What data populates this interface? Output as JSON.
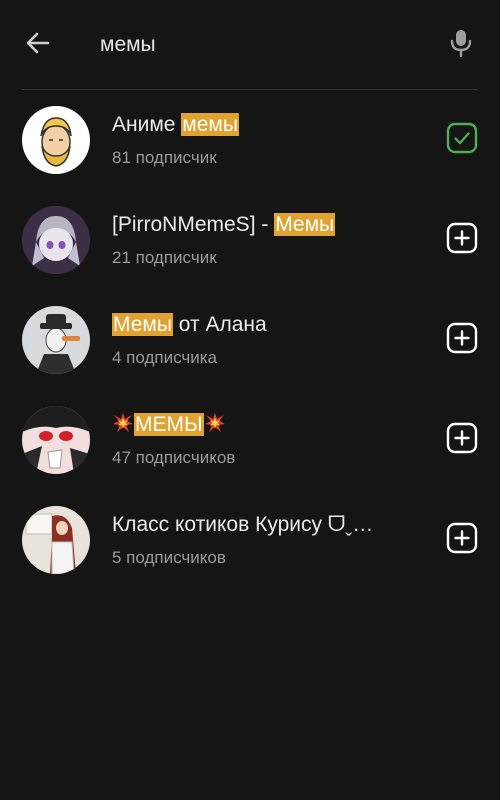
{
  "search": {
    "query": "мемы",
    "back_icon": "arrow-left-icon",
    "mic_icon": "microphone-icon"
  },
  "colors": {
    "background": "#151515",
    "highlight": "#e0a230",
    "subscribed": "#4caf50",
    "text_primary": "#ececec",
    "text_secondary": "#9a9a9a"
  },
  "results": [
    {
      "name_before": "Аниме ",
      "name_highlight": "мемы",
      "name_after": "",
      "subscribers": "81 подписчик",
      "status": "subscribed",
      "action_icon": "checkbox-checked-icon"
    },
    {
      "name_before": "[PirroNMemeS] - ",
      "name_highlight": "Мемы",
      "name_after": "",
      "subscribers": "21 подписчик",
      "status": "not-subscribed",
      "action_icon": "add-square-icon"
    },
    {
      "name_before": "",
      "name_highlight": "Мемы",
      "name_after": " от Алана",
      "subscribers": "4 подписчика",
      "status": "not-subscribed",
      "action_icon": "add-square-icon"
    },
    {
      "name_before": "",
      "name_highlight": "МЕМЫ",
      "name_after": "",
      "subscribers": "47 подписчиков",
      "status": "not-subscribed",
      "action_icon": "add-square-icon",
      "emoji": "collision-emoji"
    },
    {
      "name_before": "Класс котиков Курису ᗜˬ…",
      "name_highlight": "",
      "name_after": "",
      "subscribers": "5 подписчиков",
      "status": "not-subscribed",
      "action_icon": "add-square-icon"
    }
  ]
}
